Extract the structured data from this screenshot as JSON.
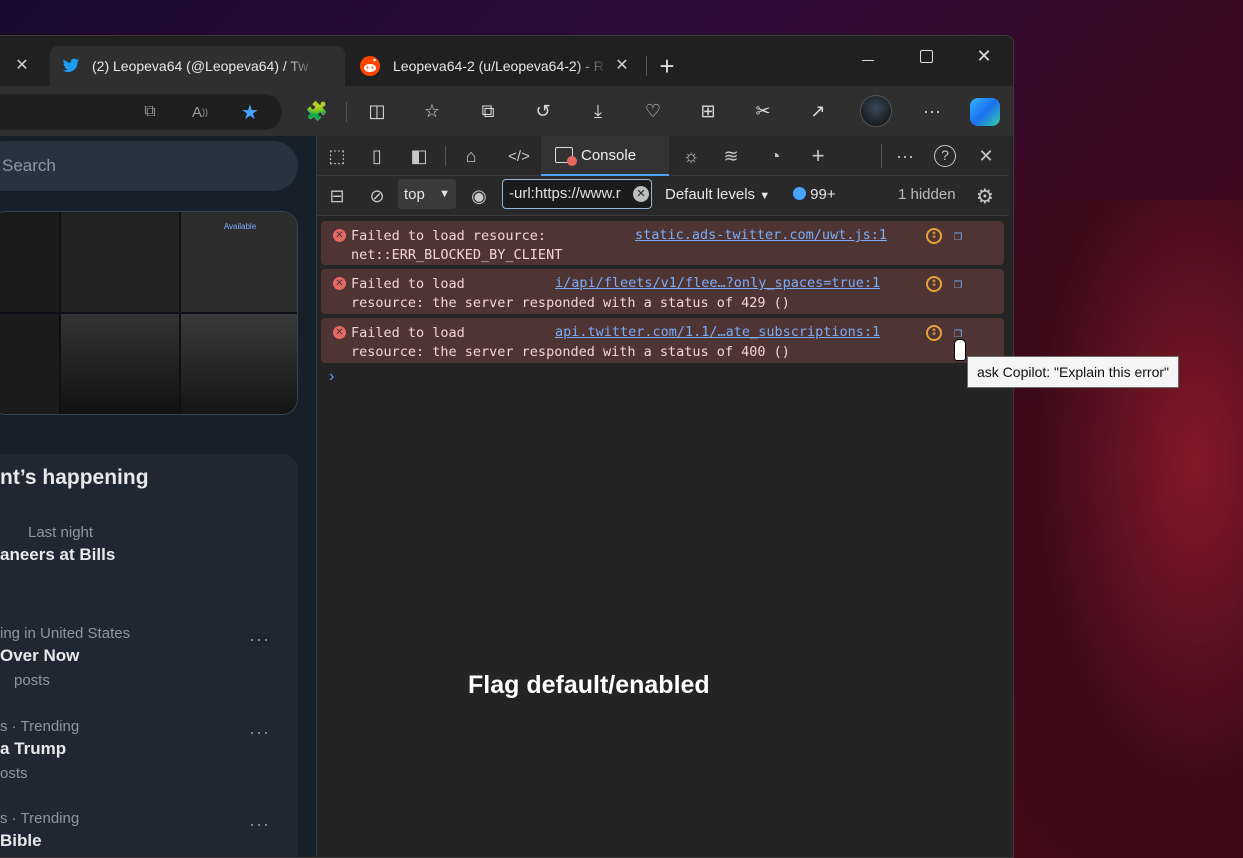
{
  "browser": {
    "tabs": [
      {
        "label": "(2) Leopeva64 (@Leopeva64) / Tw",
        "icon": "twitter-bird-icon",
        "active": true
      },
      {
        "label": "Leopeva64-2 (u/Leopeva64-2) - R",
        "icon": "reddit-icon",
        "active": false
      }
    ],
    "new_tab_symbol": "+",
    "close_symbol": "✕"
  },
  "page": {
    "search_placeholder": "Search",
    "media_caption": "Available",
    "happening_title": "nt’s happening",
    "trends": [
      {
        "meta": "Last night",
        "name": "aneers at Bills",
        "posts": ""
      },
      {
        "meta": "ing in United States",
        "name": "Over Now",
        "posts": "posts"
      },
      {
        "meta": "s · Trending",
        "name": "a Trump",
        "posts": "osts"
      },
      {
        "meta": "s · Trending",
        "name": "Bible",
        "posts": ""
      }
    ],
    "more_symbol": "···"
  },
  "devtools": {
    "console_tab_label": "Console",
    "context_label": "top",
    "filter_value": "-url:https://www.r",
    "levels_label": "Default levels",
    "issues_count": "99+",
    "hidden_label": "1 hidden",
    "messages": [
      {
        "text": "Failed to load resource:\nnet::ERR_BLOCKED_BY_CLIENT",
        "source": "static.ads-twitter.com/uwt.js:1"
      },
      {
        "text": "Failed to load\nresource: the server responded with a status of 429 ()",
        "source": "i/api/fleets/v1/flee…?only_spaces=true:1"
      },
      {
        "text": "Failed to load\nresource: the server responded with a status of 400 ()",
        "source": "api.twitter.com/1.1/…ate_subscriptions:1"
      }
    ],
    "prompt_symbol": "›",
    "tooltip": "ask Copilot: \"Explain this error\""
  },
  "annotation": "Flag default/enabled"
}
